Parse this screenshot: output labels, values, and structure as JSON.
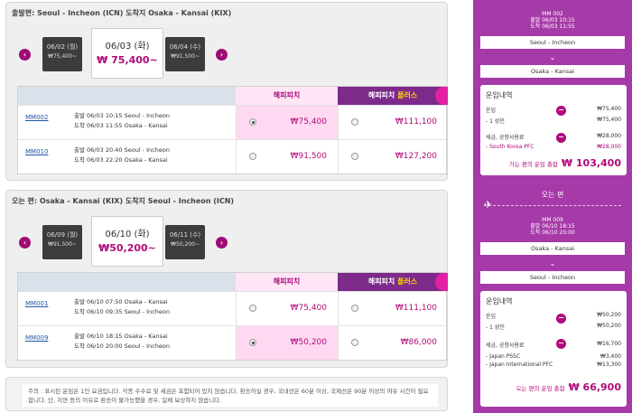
{
  "outbound": {
    "title": "출발편:  Seoul - Incheon (ICN)  도착지  Osaka - Kansai (KIX)",
    "dates": [
      {
        "date": "06/02 (월)",
        "price": "₩75,400~"
      },
      {
        "date": "06/03 (화)",
        "price": "₩ 75,400~",
        "selected": true
      },
      {
        "date": "06/04 (수)",
        "price": "₩91,500~"
      }
    ],
    "header": {
      "happy": "해피피치",
      "happy_plus_prefix": "해피피치 ",
      "happy_plus_suffix": "플러스"
    },
    "flights": [
      {
        "no": "MM002",
        "legs": [
          "출발  06/03  10:15   Seoul - Incheon",
          "도착  06/03  11:55   Osaka - Kansai"
        ],
        "happy": "₩75,400",
        "plus": "₩111,100",
        "selected": "happy"
      },
      {
        "no": "MM010",
        "legs": [
          "출발  06/03  20:40   Seoul - Incheon",
          "도착  06/03  22:20   Osaka - Kansai"
        ],
        "happy": "₩91,500",
        "plus": "₩127,200",
        "selected": "none"
      }
    ]
  },
  "return": {
    "title": "오는 편:  Osaka - Kansai (KIX)  도착지  Seoul - Incheon (ICN)",
    "dates": [
      {
        "date": "06/09 (월)",
        "price": "₩91,500~"
      },
      {
        "date": "06/10 (화)",
        "price": "₩50,200~",
        "selected": true
      },
      {
        "date": "06/11 (수)",
        "price": "₩50,200~"
      }
    ],
    "header": {
      "happy": "해피피치",
      "happy_plus_prefix": "해피피치 ",
      "happy_plus_suffix": "플러스"
    },
    "flights": [
      {
        "no": "MM001",
        "legs": [
          "출발  06/10  07:50   Osaka - Kansai",
          "도착  06/10  09:35   Seoul - Incheon"
        ],
        "happy": "₩75,400",
        "plus": "₩111,100",
        "selected": "none"
      },
      {
        "no": "MM009",
        "legs": [
          "출발  06/10  18:15   Osaka - Kansai",
          "도착  06/10  20:00   Seoul - Incheon"
        ],
        "happy": "₩50,200",
        "plus": "₩86,000",
        "selected": "happy"
      }
    ]
  },
  "notice": "주의 : 표시된 운임은 1인 요금입니다. 각종 수수료 및 세금은 포함되어 있지 않습니다. 환승하실 경우, 국내선은 60분 이상, 국제선은 90분 이상의 여유 시간이 필요합니다. 단, 지연 등의 이유로 환승이 불가능했을 경우, 일체 보상하지 않습니다.",
  "summary": {
    "outbound": {
      "flight_no": "MM 002",
      "dep": "출발  06/03  10:15",
      "arr": "도착  06/03  11:55",
      "from": "Seoul - Incheon",
      "to": "Osaka - Kansai",
      "fare_title": "운임내역",
      "fare_label": "운임",
      "fare_value": "₩75,400",
      "pax": "- 1     성인",
      "pax_value": "₩75,400",
      "tax_label": "세금, 공항사용료",
      "tax_value": "₩28,000",
      "tax_item": "- South Korea PFC",
      "tax_item_value": "₩28,000",
      "total_label": "가는 편의 운임 총합",
      "total": "₩ 103,400"
    },
    "return_label": "오는 편",
    "return": {
      "flight_no": "MM 009",
      "dep": "출발  06/10  18:15",
      "arr": "도착  06/10  20:00",
      "from": "Osaka - Kansai",
      "to": "Seoul - Incheon",
      "fare_title": "운임내역",
      "fare_label": "운임",
      "fare_value": "₩50,200",
      "pax": "- 1     성인",
      "pax_value": "₩50,200",
      "tax_label": "세금, 공항사용료",
      "tax_value": "₩16,700",
      "tax_item1": "- Japan PSSC",
      "tax_item1_value": "₩3,400",
      "tax_item2": "- Japan International PFC",
      "tax_item2_value": "₩13,300",
      "total_label": "오는 편의 운임 총합",
      "total": "₩ 66,900"
    }
  },
  "colors": {
    "accent": "#b10a7a",
    "sidebar": "#a63aa8",
    "plus_header": "#7d2a8b"
  }
}
